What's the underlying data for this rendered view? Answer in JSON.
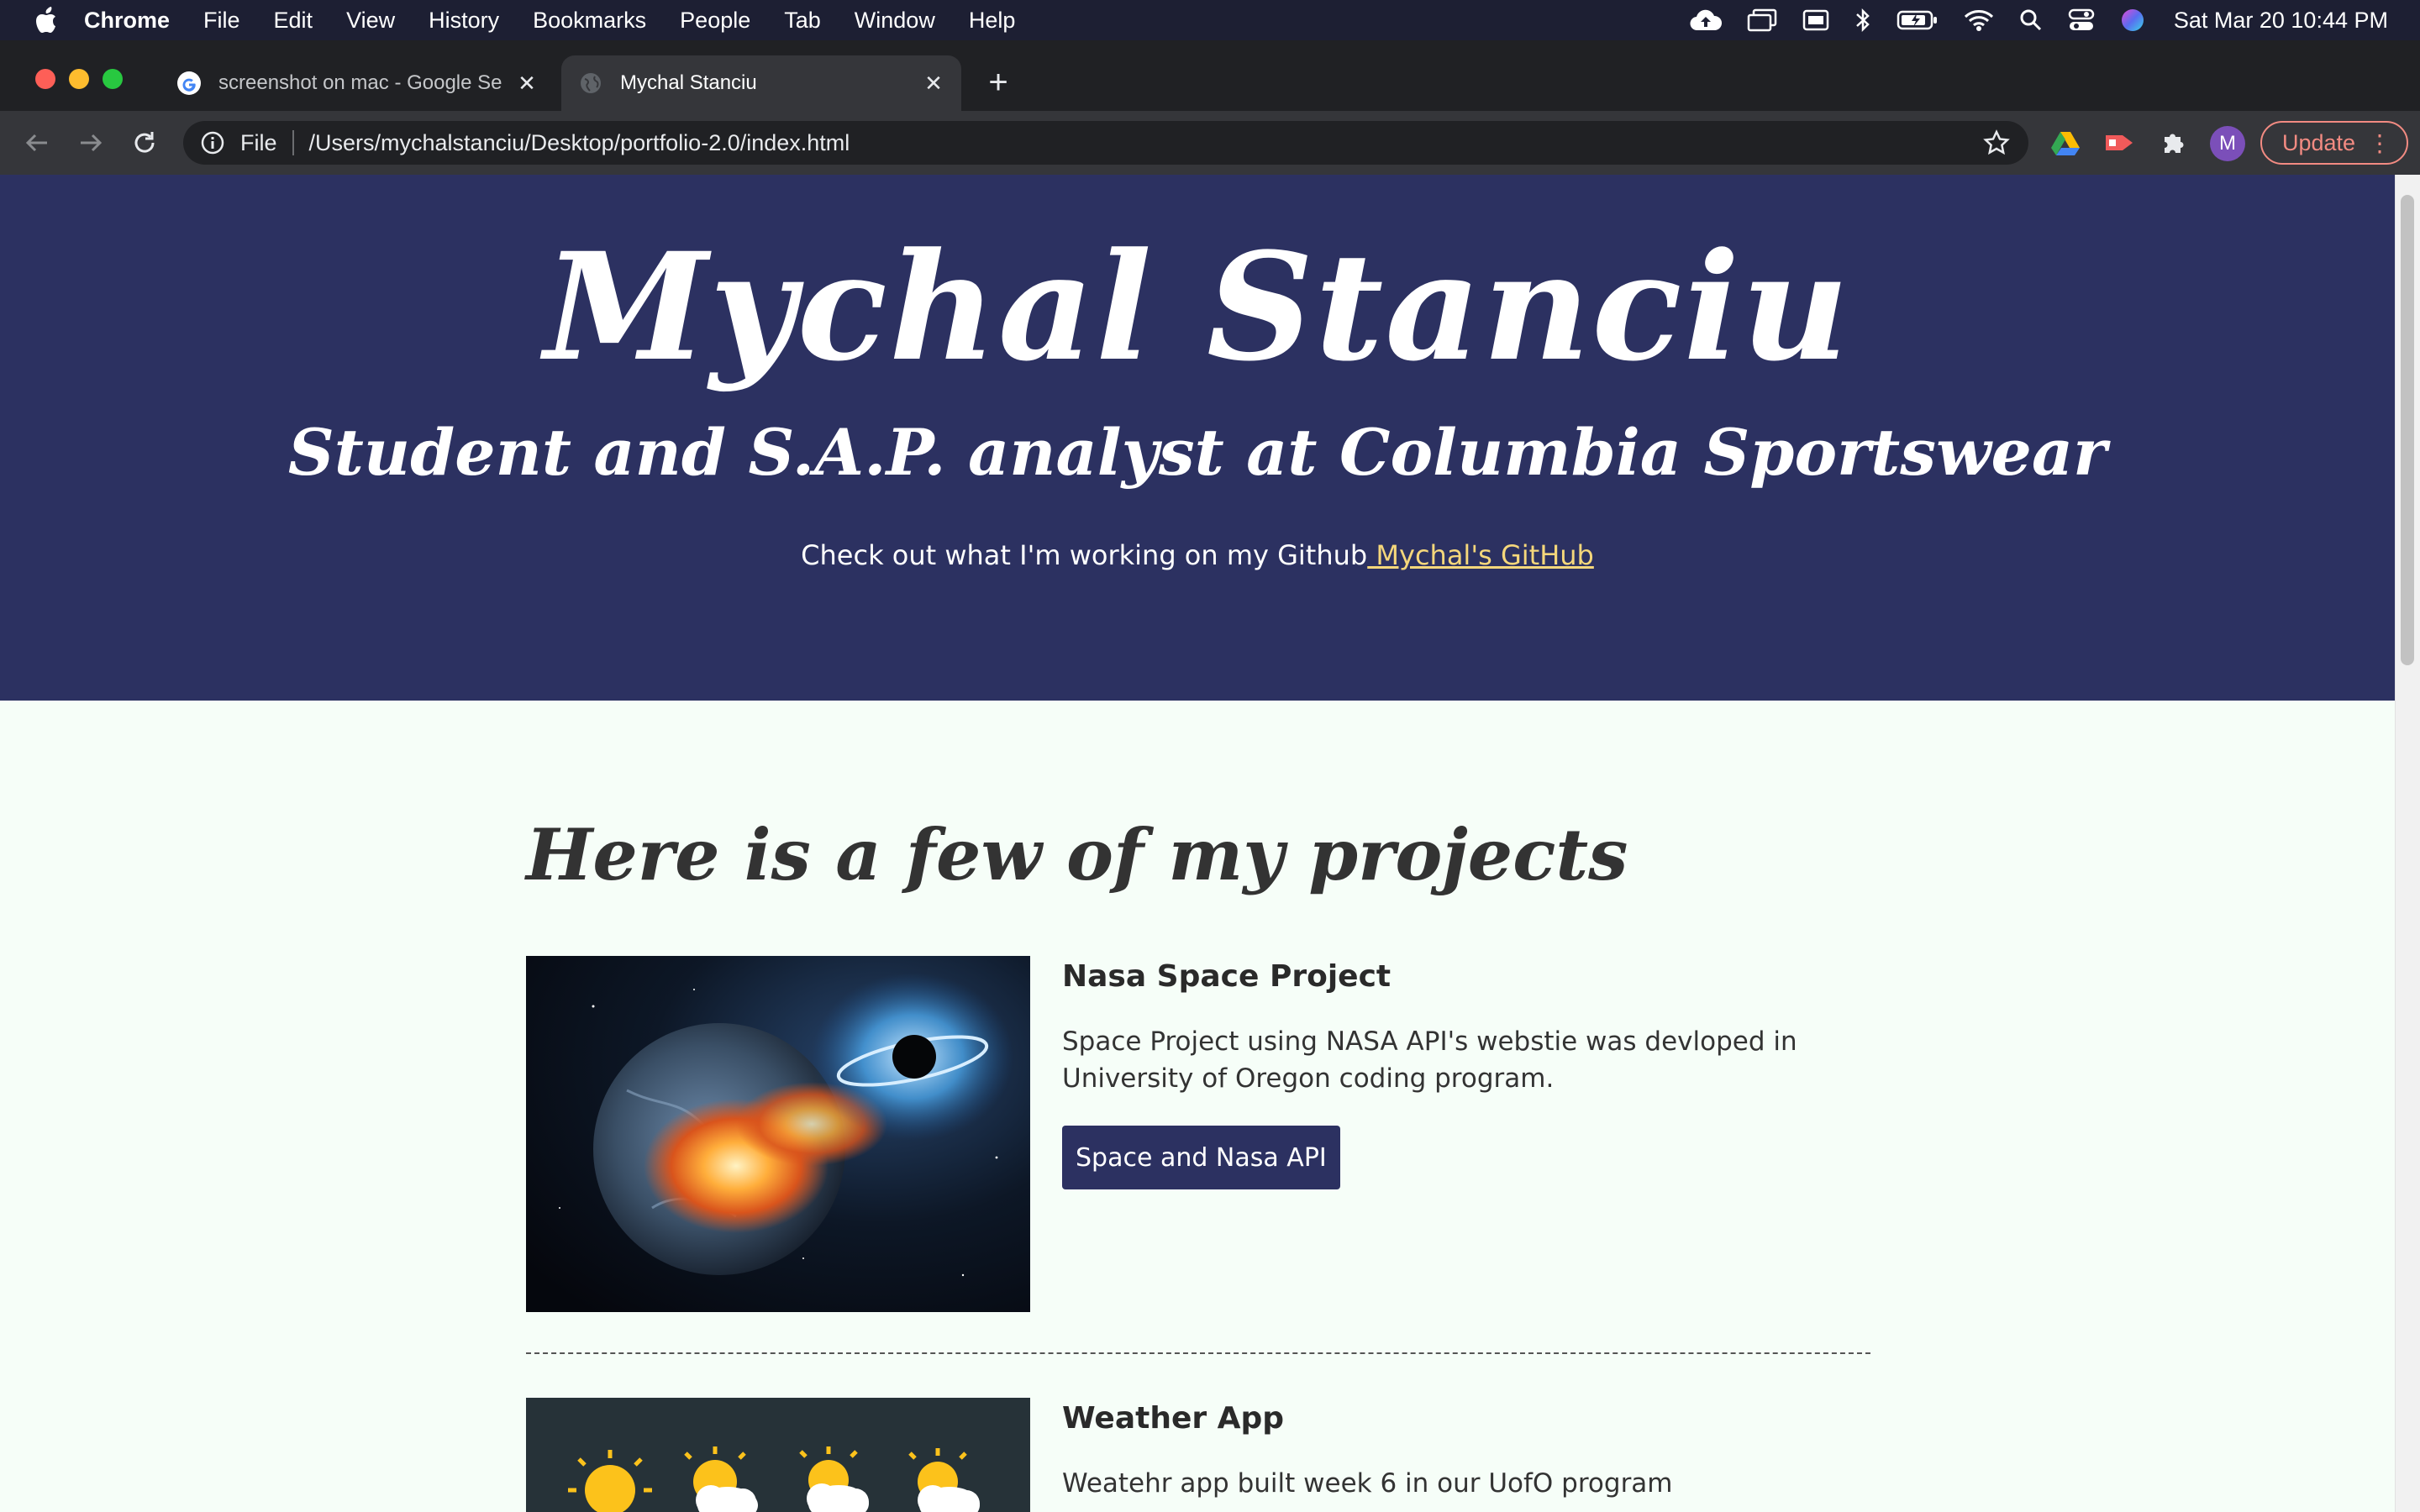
{
  "menubar": {
    "app_name": "Chrome",
    "menus": [
      "File",
      "Edit",
      "View",
      "History",
      "Bookmarks",
      "People",
      "Tab",
      "Window",
      "Help"
    ],
    "clock": "Sat Mar 20  10:44 PM"
  },
  "tabs": [
    {
      "title": "screenshot on mac - Google Se",
      "favicon": "google-icon",
      "active": false
    },
    {
      "title": "Mychal Stanciu",
      "favicon": "globe-icon",
      "active": true
    }
  ],
  "address_bar": {
    "scheme": "File",
    "url": "/Users/mychalstanciu/Desktop/portfolio-2.0/index.html"
  },
  "profile": {
    "initial": "M"
  },
  "update_button": {
    "label": "Update"
  },
  "hero": {
    "name": "Mychal Stanciu",
    "subtitle": "Student and S.A.P. analyst at Columbia Sportswear",
    "cta_text": "Check out what I'm working on my Github",
    "cta_link": " Mychal's GitHub"
  },
  "projects_heading": "Here is a few of my projects",
  "projects": [
    {
      "title": "Nasa Space Project",
      "description": "Space Project using NASA API's webstie was devloped in University of Oregon coding program.",
      "button": "Space and Nasa API"
    },
    {
      "title": "Weather App",
      "description": "Weatehr app built week 6 in our UofO program"
    }
  ],
  "colors": {
    "hero_bg": "#2c3161",
    "link": "#f5d77b",
    "page_bg": "#f6fef8",
    "update": "#f28b82"
  }
}
